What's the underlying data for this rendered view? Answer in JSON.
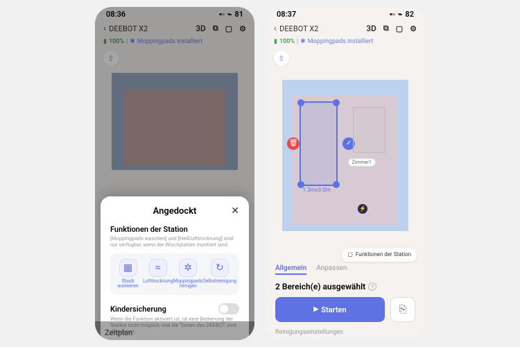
{
  "left": {
    "status": {
      "time": "08:36",
      "signal": "▪▫",
      "wifi": "⌁",
      "battery": "81"
    },
    "header": {
      "back": "‹",
      "title": "DEEBOT X2",
      "badge": "3D",
      "icons": [
        "⧉",
        "▢",
        "⚙"
      ]
    },
    "sub": {
      "batt_icon": "▮",
      "pct": "100%",
      "pipe": "|",
      "gear": "✱",
      "link": "Moppingpads installiert"
    },
    "map": {},
    "sheet": {
      "title": "Angedockt",
      "close": "✕",
      "section1": {
        "title": "Funktionen der Station",
        "sub": "[Moppingpads waschen] und [Heißlufttrocknung] sind nur verfügbar, wenn die Wischplatten montiert sind."
      },
      "funcs": [
        {
          "icon": "▦",
          "label": "Staub ausleeren"
        },
        {
          "icon": "≈",
          "label": "Lufttrocknung"
        },
        {
          "icon": "✲",
          "label": "Moppingpads reinigen"
        },
        {
          "icon": "↻",
          "label": "Selbstreinigung"
        }
      ],
      "child": {
        "title": "Kindersicherung",
        "sub": "Wenn die Funktion aktiviert ist, ist eine Bedienung der Station nicht möglich, und die Tasten des DEEBOT sind deaktiviert."
      }
    },
    "zeitplan": "Zeitplan"
  },
  "right": {
    "status": {
      "time": "08:37",
      "signal": "▪▫",
      "wifi": "⌁",
      "battery": "82"
    },
    "header": {
      "back": "‹",
      "title": "DEEBOT X2",
      "badge": "3D",
      "icons": [
        "⧉",
        "▢",
        "⚙"
      ]
    },
    "sub": {
      "batt_icon": "▮",
      "pct": "100%",
      "pipe": "|",
      "gear": "✱",
      "link": "Moppingpads installiert"
    },
    "zone": {
      "dim": "1.3mx3.0m"
    },
    "room_label": "Zimmer1",
    "funcs_pill": {
      "icon": "▢",
      "text": "Funktionen der Station"
    },
    "tabs": {
      "t1": "Allgemein",
      "t2": "Anpassen"
    },
    "selected": "2 Bereich(e) ausgewählt",
    "start": {
      "play": "▶",
      "label": "Starten"
    },
    "save_icon": "⎘",
    "settings": "Reinigungseinstellungen"
  }
}
